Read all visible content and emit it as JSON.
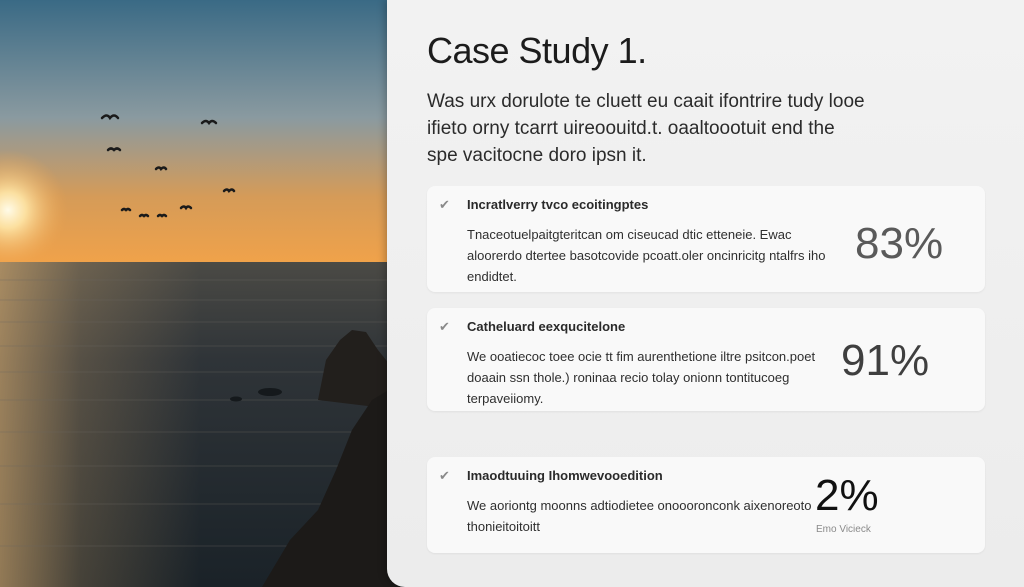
{
  "case_study": {
    "title": "Case Study 1.",
    "intro": "Was urx dorulote te cluett eu caait ifontrire tudy looe ifieto orny tcarrt uireoouitd.t. oaaltoootuit end the spe vacitocne doro ipsn it."
  },
  "cards": [
    {
      "heading": "Incratlverry tvco ecoitingptes",
      "body": "Tnaceotuelpaitgteritcan om ciseucad dtic etteneie. Ewac aloorerdo dtertee basotcovide pcoatt.oler oncinricitg ntalfrs iho endidtet.",
      "metric": "83%"
    },
    {
      "heading": "Catheluard eexqucitelone",
      "body": "We ooatiecoc toee ocie tt fim aurenthetione iltre psitcon.poet doaain ssn thole.) roninaa recio tolay onionn tontitucoeg terpaveiiomy.",
      "metric": "91%"
    },
    {
      "heading": "Imaodtuuing Ihomwevooedition",
      "body": "We aoriontg moonns adtiodietee onoooronconk aixenoreoto thonieitoitoitt",
      "metric": "2%",
      "metric_caption": "Emo Vicieck"
    }
  ],
  "icons": {
    "check": "checkmark-icon"
  },
  "colors": {
    "panel_bg": "#efefef",
    "card_bg": "#f9f9f9",
    "sky_top": "#3a6a85",
    "sunset": "#f0a24a",
    "sea": "#1f2b33"
  }
}
